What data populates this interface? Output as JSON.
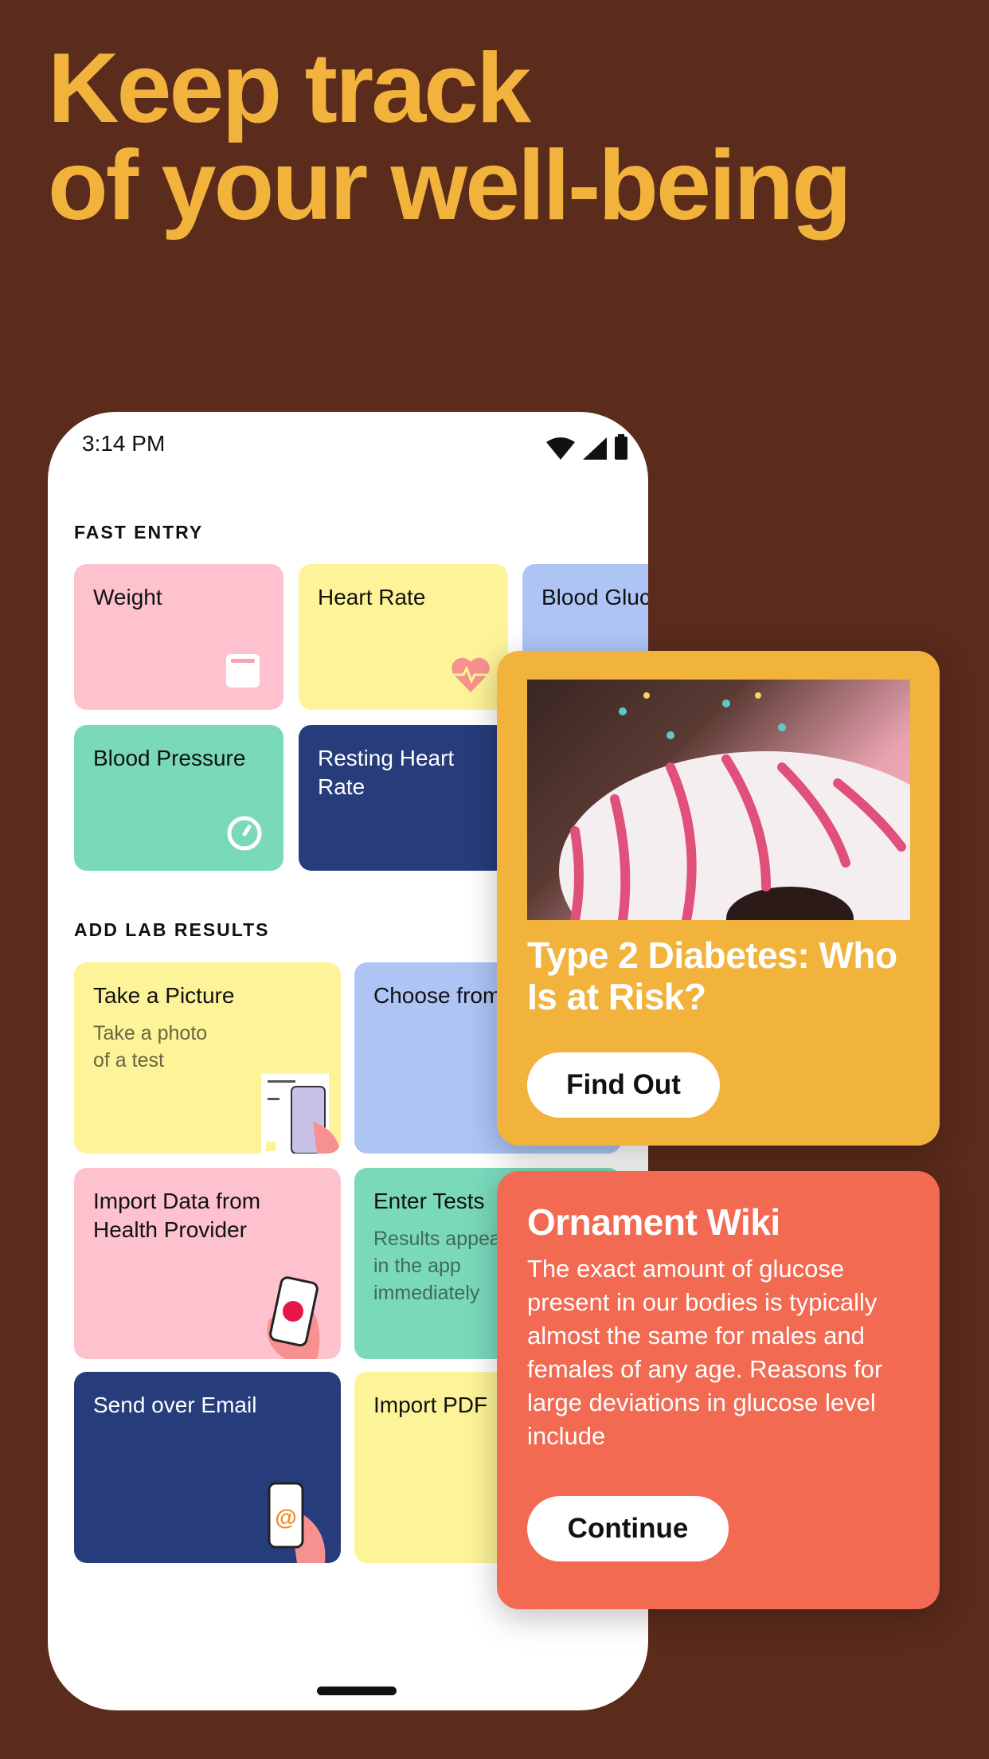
{
  "headline": {
    "line1": "Keep track",
    "line2": "of your well-being"
  },
  "status": {
    "time": "3:14 PM"
  },
  "fast_entry": {
    "title": "FAST ENTRY",
    "tiles": [
      {
        "label": "Weight",
        "color": "#fec1ce",
        "icon": "scale-icon"
      },
      {
        "label": "Heart Rate",
        "color": "#fdf398",
        "icon": "heart-pulse-icon"
      },
      {
        "label": "Blood Gluc",
        "color": "#adc4f5"
      },
      {
        "label": "Blood Pressure",
        "color": "#7ad8bb",
        "icon": "gauge-icon"
      },
      {
        "label": "Resting Heart Rate",
        "color": "#263c7b"
      }
    ]
  },
  "lab_results": {
    "title": "ADD LAB RESULTS",
    "tiles": [
      {
        "label": "Take a Picture",
        "sub": "Take a photo of a test"
      },
      {
        "label": "Choose from"
      },
      {
        "label": "Import Data from Health Provider"
      },
      {
        "label": "Enter Tests",
        "sub": "Results appear in the app immediately"
      },
      {
        "label": "Send over Email"
      },
      {
        "label": "Import PDF"
      }
    ]
  },
  "article_card": {
    "title": "Type 2 Diabetes: Who Is at Risk?",
    "button": "Find Out",
    "color": "#f2b33d"
  },
  "wiki_card": {
    "title": "Ornament Wiki",
    "body": "The exact amount of glucose present in our bodies is typically almost the same for males and females of any age. Reasons for large deviations in glucose level include",
    "button": "Continue",
    "color": "#f26a52"
  }
}
